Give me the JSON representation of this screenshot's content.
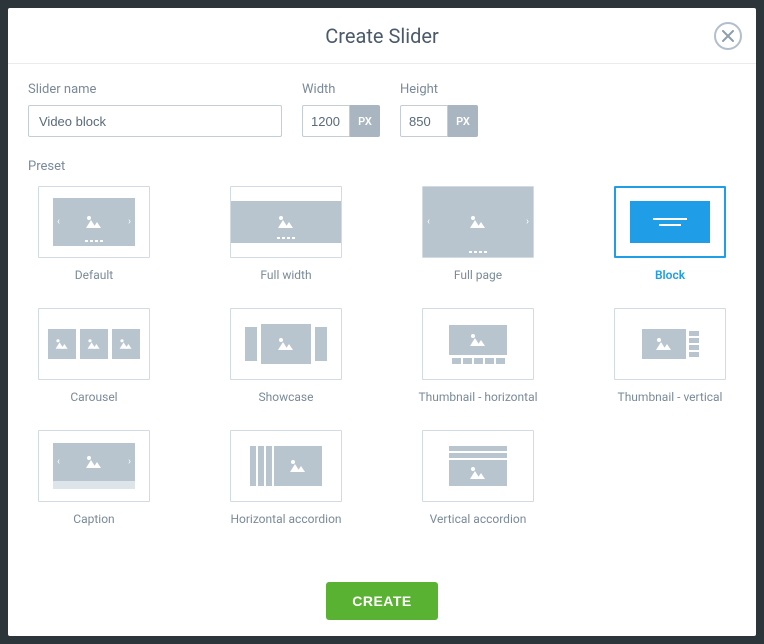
{
  "header": {
    "title": "Create Slider"
  },
  "form": {
    "name_label": "Slider name",
    "name_value": "Video block",
    "width_label": "Width",
    "width_value": "1200",
    "height_label": "Height",
    "height_value": "850",
    "unit": "PX"
  },
  "preset_label": "Preset",
  "presets": [
    {
      "id": "default",
      "label": "Default",
      "selected": false
    },
    {
      "id": "fullwidth",
      "label": "Full width",
      "selected": false
    },
    {
      "id": "fullpage",
      "label": "Full page",
      "selected": false
    },
    {
      "id": "block",
      "label": "Block",
      "selected": true
    },
    {
      "id": "carousel",
      "label": "Carousel",
      "selected": false
    },
    {
      "id": "showcase",
      "label": "Showcase",
      "selected": false
    },
    {
      "id": "thumb_h",
      "label": "Thumbnail - horizontal",
      "selected": false
    },
    {
      "id": "thumb_v",
      "label": "Thumbnail - vertical",
      "selected": false
    },
    {
      "id": "caption",
      "label": "Caption",
      "selected": false
    },
    {
      "id": "h_accordion",
      "label": "Horizontal accordion",
      "selected": false
    },
    {
      "id": "v_accordion",
      "label": "Vertical accordion",
      "selected": false
    }
  ],
  "footer": {
    "create_label": "CREATE"
  }
}
